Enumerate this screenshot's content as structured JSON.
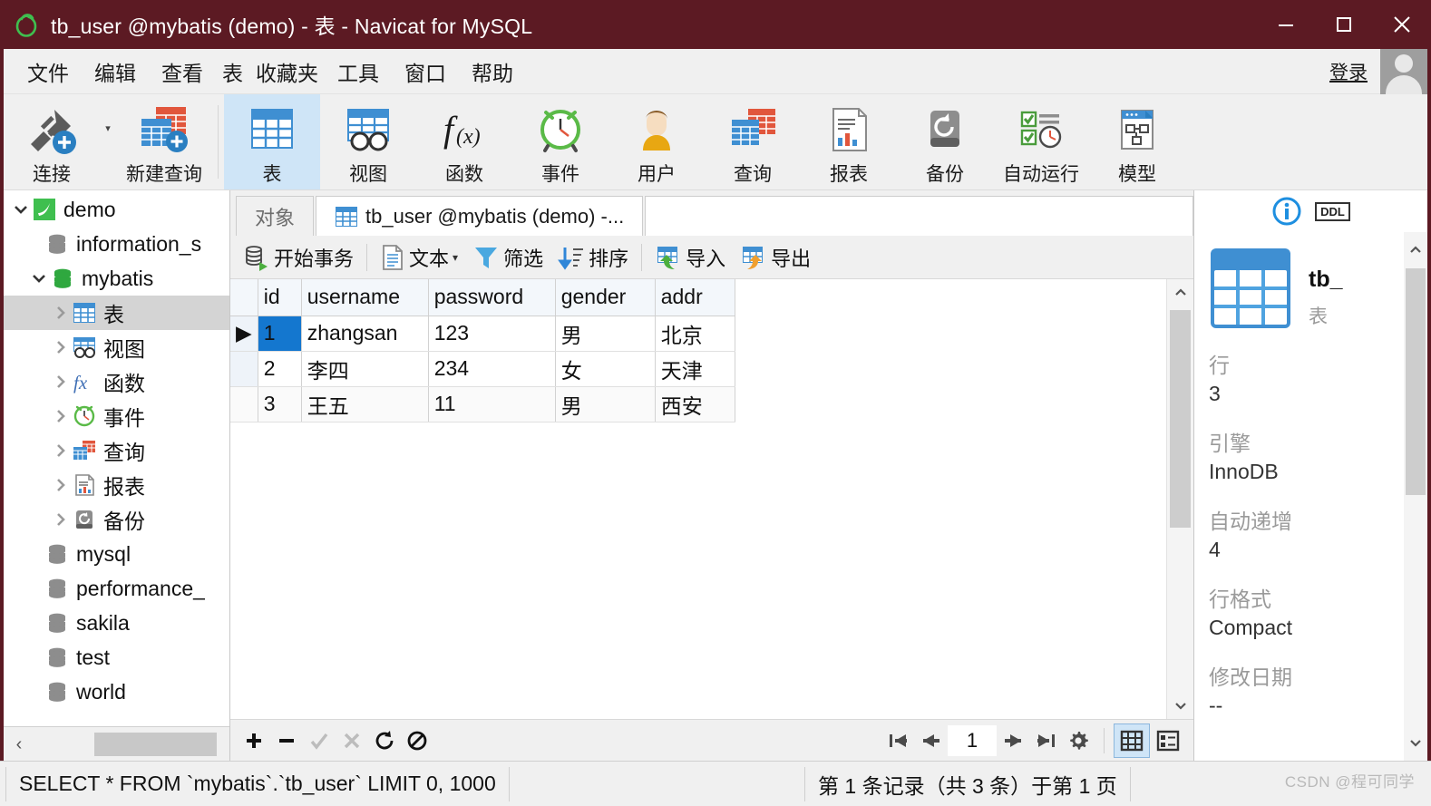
{
  "window": {
    "title": "tb_user @mybatis (demo) - 表 - Navicat for MySQL",
    "logo_icon": "navicat-logo-icon",
    "minimize_label": "—",
    "maximize_label": "□",
    "close_label": "✕"
  },
  "menubar": {
    "items": [
      {
        "label": "文件",
        "name": "menu-file"
      },
      {
        "label": "编辑",
        "name": "menu-edit"
      },
      {
        "label": "查看",
        "name": "menu-view"
      },
      {
        "label": "表",
        "name": "menu-table"
      },
      {
        "label": "收藏夹",
        "name": "menu-favorites"
      },
      {
        "label": "工具",
        "name": "menu-tools"
      },
      {
        "label": "窗口",
        "name": "menu-window"
      },
      {
        "label": "帮助",
        "name": "menu-help"
      }
    ],
    "login_label": "登录",
    "avatar_icon": "user-avatar-icon"
  },
  "ribbon": {
    "buttons": [
      {
        "label": "连接",
        "icon": "connection-plug-icon",
        "selected": false
      },
      {
        "label": "新建查询",
        "icon": "new-query-icon",
        "selected": false
      },
      {
        "label": "表",
        "icon": "table-icon",
        "selected": true
      },
      {
        "label": "视图",
        "icon": "view-glasses-icon",
        "selected": false
      },
      {
        "label": "函数",
        "icon": "function-fx-icon",
        "selected": false
      },
      {
        "label": "事件",
        "icon": "event-clock-icon",
        "selected": false
      },
      {
        "label": "用户",
        "icon": "user-person-icon",
        "selected": false
      },
      {
        "label": "查询",
        "icon": "query-tables-icon",
        "selected": false
      },
      {
        "label": "报表",
        "icon": "report-chart-doc-icon",
        "selected": false
      },
      {
        "label": "备份",
        "icon": "backup-restore-icon",
        "selected": false
      },
      {
        "label": "自动运行",
        "icon": "automation-schedule-icon",
        "selected": false
      },
      {
        "label": "模型",
        "icon": "model-diagram-icon",
        "selected": false
      }
    ]
  },
  "sidebar": {
    "tree": [
      {
        "label": "demo",
        "icon": "mysql-connection-icon",
        "indent": 0,
        "twisty": "down",
        "selected": false
      },
      {
        "label": "information_s",
        "icon": "database-grey-icon",
        "indent": 1,
        "twisty": "none",
        "selected": false
      },
      {
        "label": "mybatis",
        "icon": "database-green-icon",
        "indent": 1,
        "twisty": "down",
        "selected": false
      },
      {
        "label": "表",
        "icon": "table-icon",
        "indent": 2,
        "twisty": "right",
        "selected": true
      },
      {
        "label": "视图",
        "icon": "view-glasses-icon",
        "indent": 2,
        "twisty": "right",
        "selected": false
      },
      {
        "label": "函数",
        "icon": "function-fx-icon",
        "indent": 2,
        "twisty": "right",
        "selected": false
      },
      {
        "label": "事件",
        "icon": "event-clock-icon",
        "indent": 2,
        "twisty": "right",
        "selected": false
      },
      {
        "label": "查询",
        "icon": "query-tables-icon",
        "indent": 2,
        "twisty": "right",
        "selected": false
      },
      {
        "label": "报表",
        "icon": "report-chart-doc-icon",
        "indent": 2,
        "twisty": "right",
        "selected": false
      },
      {
        "label": "备份",
        "icon": "backup-restore-icon",
        "indent": 2,
        "twisty": "right",
        "selected": false
      },
      {
        "label": "mysql",
        "icon": "database-grey-icon",
        "indent": 1,
        "twisty": "none",
        "selected": false
      },
      {
        "label": "performance_",
        "icon": "database-grey-icon",
        "indent": 1,
        "twisty": "none",
        "selected": false
      },
      {
        "label": "sakila",
        "icon": "database-grey-icon",
        "indent": 1,
        "twisty": "none",
        "selected": false
      },
      {
        "label": "test",
        "icon": "database-grey-icon",
        "indent": 1,
        "twisty": "none",
        "selected": false
      },
      {
        "label": "world",
        "icon": "database-grey-icon",
        "indent": 1,
        "twisty": "none",
        "selected": false
      }
    ],
    "scroll_left_icon": "chevron-left-icon",
    "scroll_right_icon": "chevron-right-icon"
  },
  "tabs": [
    {
      "label": "对象",
      "name": "tab-objects",
      "active": false,
      "icon": "none"
    },
    {
      "label": "tb_user @mybatis (demo) -...",
      "name": "tab-tb-user",
      "active": true,
      "icon": "table-icon"
    }
  ],
  "gridbar": {
    "buttons": [
      {
        "label": "开始事务",
        "icon": "begin-transaction-icon",
        "caret": false
      },
      {
        "label": "文本",
        "icon": "text-doc-icon",
        "caret": true
      },
      {
        "label": "筛选",
        "icon": "filter-funnel-icon",
        "caret": false
      },
      {
        "label": "排序",
        "icon": "sort-icon",
        "caret": false
      },
      {
        "label": "导入",
        "icon": "import-icon",
        "caret": false
      },
      {
        "label": "导出",
        "icon": "export-icon",
        "caret": false
      }
    ]
  },
  "grid": {
    "columns": [
      "id",
      "username",
      "password",
      "gender",
      "addr"
    ],
    "rows": [
      {
        "id": "1",
        "username": "zhangsan",
        "password": "123",
        "gender": "男",
        "addr": "北京",
        "current": true
      },
      {
        "id": "2",
        "username": "李四",
        "password": "234",
        "gender": "女",
        "addr": "天津",
        "current": false
      },
      {
        "id": "3",
        "username": "王五",
        "password": "11",
        "gender": "男",
        "addr": "西安",
        "current": false
      }
    ],
    "selected_cell": {
      "row": 0,
      "column": "id"
    },
    "row_marker_icon": "current-row-arrow-icon"
  },
  "infopanel": {
    "info_icon": "info-circle-icon",
    "ddl_label": "DDL",
    "table_icon": "table-icon",
    "object_name": "tb_",
    "object_kind": "表",
    "fields": [
      {
        "key": "行",
        "value": "3"
      },
      {
        "key": "引擎",
        "value": "InnoDB"
      },
      {
        "key": "自动递增",
        "value": "4"
      },
      {
        "key": "行格式",
        "value": "Compact"
      },
      {
        "key": "修改日期",
        "value": "--"
      }
    ],
    "scroll_up_icon": "chevron-up-icon",
    "scroll_down_icon": "chevron-down-icon"
  },
  "navbar": {
    "left_buttons": [
      {
        "icon": "add-record-icon",
        "name": "add-record-button",
        "disabled": false
      },
      {
        "icon": "delete-record-icon",
        "name": "delete-record-button",
        "disabled": false
      },
      {
        "icon": "apply-change-icon",
        "name": "apply-change-button",
        "disabled": true
      },
      {
        "icon": "discard-change-icon",
        "name": "discard-change-button",
        "disabled": true
      },
      {
        "icon": "refresh-icon",
        "name": "refresh-button",
        "disabled": false
      },
      {
        "icon": "stop-icon",
        "name": "stop-button",
        "disabled": false
      }
    ],
    "page_value": "1",
    "first_icon": "first-page-icon",
    "prev_icon": "prev-page-icon",
    "next_icon": "next-page-icon",
    "last_icon": "last-page-icon",
    "settings_icon": "gear-icon",
    "grid_view_icon": "grid-view-icon",
    "form_view_icon": "form-view-icon",
    "grid_view_selected": true
  },
  "statusbar": {
    "sql": "SELECT * FROM `mybatis`.`tb_user` LIMIT 0, 1000",
    "record_info": "第 1 条记录（共 3 条）于第 1 页",
    "watermark": "CSDN @程可同学"
  }
}
